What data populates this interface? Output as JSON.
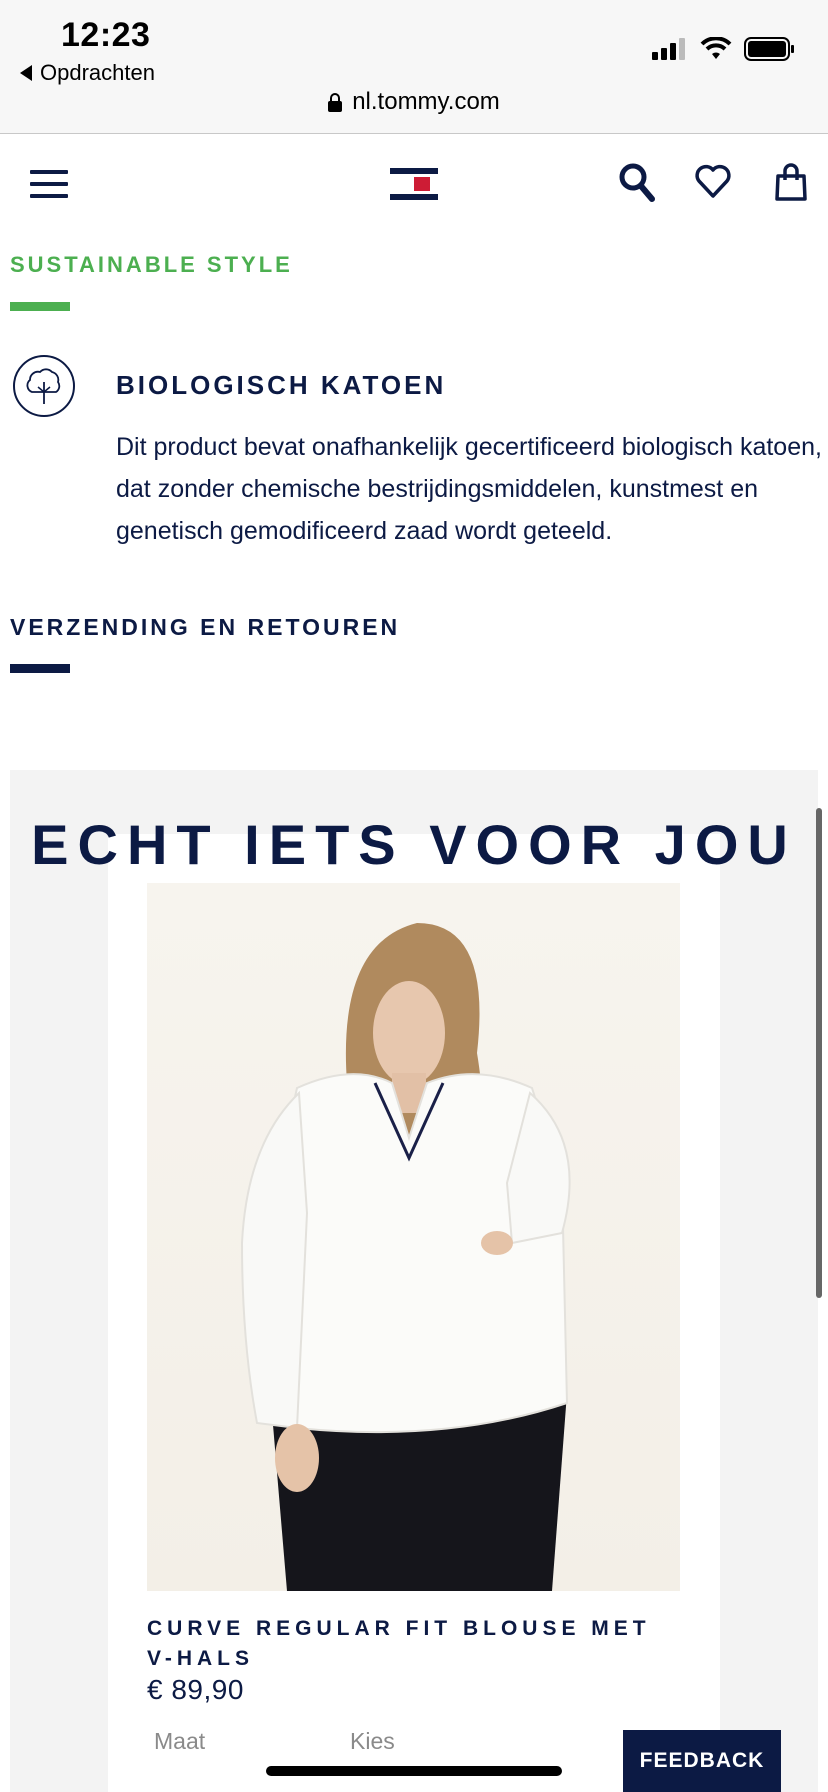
{
  "status_bar": {
    "time": "12:23",
    "back_label": "Opdrachten",
    "url": "nl.tommy.com"
  },
  "header": {
    "menu_icon": "hamburger-icon",
    "logo_icon": "tommy-flag-logo",
    "search_icon": "search-icon",
    "wishlist_icon": "heart-icon",
    "bag_icon": "shopping-bag-icon"
  },
  "sustainable": {
    "title": "SUSTAINABLE STYLE",
    "accent_color": "#4caf50",
    "item_title": "BIOLOGISCH KATOEN",
    "item_text": "Dit product bevat onafhankelijk gecertificeerd biologisch katoen, dat zonder chemische bestrijdingsmiddelen, kunstmest en genetisch gemodificeerd zaad wordt geteeld.",
    "item_icon": "cotton-icon"
  },
  "shipping": {
    "title": "VERZENDING EN RETOUREN"
  },
  "recommendations": {
    "title": "ECHT IETS VOOR JOU",
    "product": {
      "name": "CURVE REGULAR FIT BLOUSE MET V-HALS",
      "price": "€ 89,90",
      "size_label": "Maat",
      "size_select": "Kies"
    }
  },
  "feedback_label": "FEEDBACK",
  "colors": {
    "navy": "#0c1a44",
    "green": "#4caf50",
    "red": "#cd1c35"
  }
}
